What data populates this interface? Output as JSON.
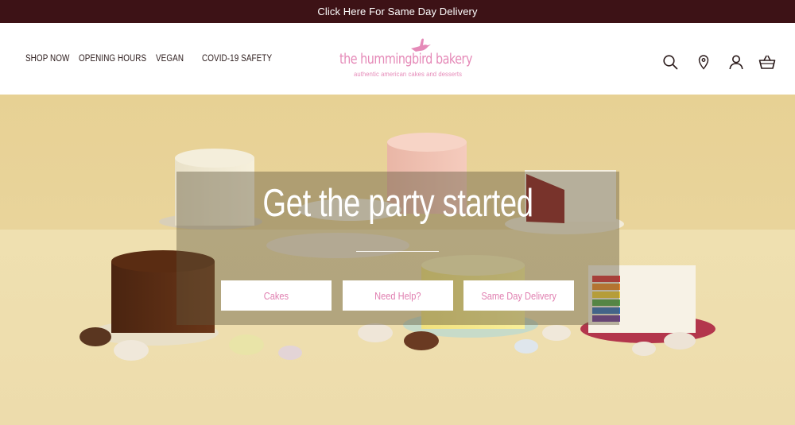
{
  "announcement": {
    "text": "Click Here For Same Day Delivery"
  },
  "nav": {
    "items": [
      {
        "label": "SHOP NOW"
      },
      {
        "label": "OPENING HOURS"
      },
      {
        "label": "VEGAN"
      },
      {
        "label": "COVID-19 SAFETY"
      }
    ]
  },
  "logo": {
    "name": "the hummingbird bakery",
    "tagline": "authentic american cakes and desserts",
    "icon": "hummingbird-icon"
  },
  "header_icons": [
    "search-icon",
    "location-pin-icon",
    "account-icon",
    "basket-icon"
  ],
  "hero": {
    "headline": "Get the party started",
    "buttons": [
      {
        "label": "Cakes"
      },
      {
        "label": "Need Help?"
      },
      {
        "label": "Same Day Delivery"
      }
    ]
  },
  "colors": {
    "announcement_bg": "#3d1216",
    "brand_pink": "#e58ab8",
    "button_text": "#e07fb0",
    "hero_bg": "#e8d39b"
  }
}
